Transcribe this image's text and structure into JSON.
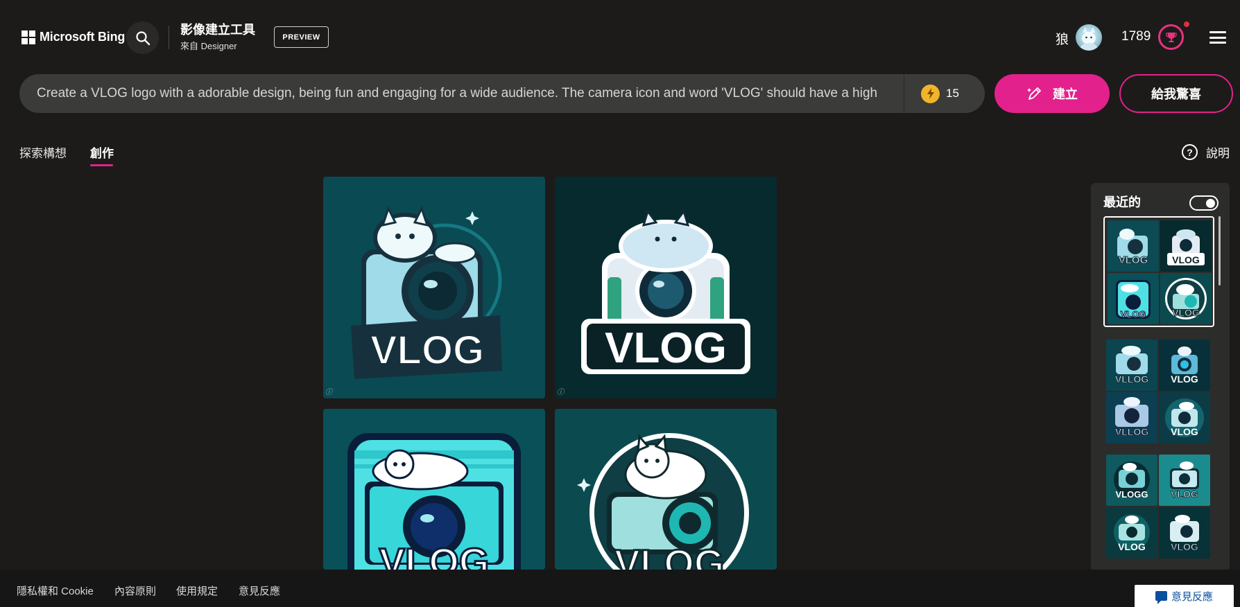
{
  "header": {
    "brand": "Microsoft Bing",
    "product_title": "影像建立工具",
    "product_subtitle": "來自 Designer",
    "preview_badge": "PREVIEW",
    "user_name": "狼",
    "points": "1789"
  },
  "prompt": {
    "text": "Create a VLOG logo with a adorable design, being fun and engaging for a wide audience. The camera icon and word 'VLOG' should have a high",
    "boosts": "15",
    "create_label": "建立",
    "surprise_label": "給我驚喜"
  },
  "tabs": [
    {
      "label": "探索構想",
      "active": false
    },
    {
      "label": "創作",
      "active": true
    }
  ],
  "help_label": "說明",
  "images": [
    {
      "logo_text": "VLOG",
      "watermark": "ⓘ"
    },
    {
      "logo_text": "VLOG",
      "watermark": "ⓘ"
    },
    {
      "logo_text": "VLOG"
    },
    {
      "logo_text": "VLOG"
    }
  ],
  "recent": {
    "title": "最近的",
    "toggle_on": true,
    "thumb_labels": [
      "VLOG",
      "VLOG",
      "VLOG",
      "VLOG",
      "VLLOG",
      "VLOG",
      "VLLOG",
      "VLOG",
      "VLOGG",
      "VLOG",
      "VLOG",
      "VLOG"
    ]
  },
  "footer": {
    "links": [
      "隱私權和 Cookie",
      "內容原則",
      "使用規定",
      "意見反應"
    ],
    "feedback_button": "意見反應"
  },
  "colors": {
    "accent": "#e3218c",
    "background": "#1c1b1a",
    "prompt_bg": "#3b3b3a",
    "footer_bg": "#161616"
  },
  "icons": [
    "search-icon",
    "pen-sparkle-icon",
    "bolt-icon",
    "trophy-icon",
    "hamburger-menu-icon",
    "help-circle-icon",
    "chat-feedback-icon"
  ]
}
